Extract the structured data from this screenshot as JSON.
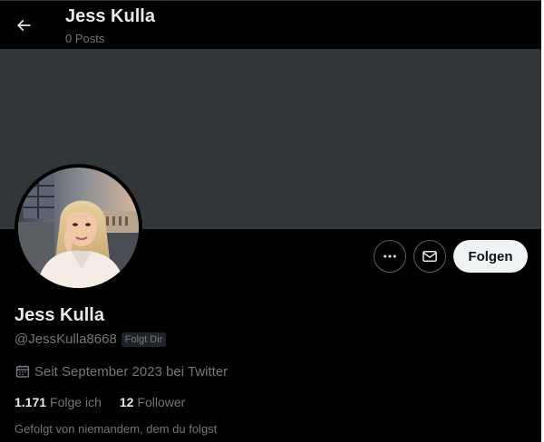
{
  "header": {
    "back_icon": "arrow-left-icon",
    "title": "Jess Kulla",
    "subtitle": "0 Posts"
  },
  "profile": {
    "banner_color": "#333639",
    "avatar_icon": "profile-photo",
    "name": "Jess Kulla",
    "handle": "@JessKulla8668",
    "follows_you_badge": "Folgt Dir",
    "joined": "Seit September 2023 bei Twitter",
    "joined_icon": "calendar-icon",
    "following_count": "1.171",
    "following_label": "Folge ich",
    "followers_count": "12",
    "followers_label": "Follower",
    "followed_by": "Gefolgt von niemandem, dem du folgst"
  },
  "actions": {
    "more_icon": "more-icon",
    "message_icon": "mail-icon",
    "follow_label": "Folgen"
  },
  "colors": {
    "background": "#000000",
    "primary_text": "#e7e9ea",
    "secondary_text": "#71767b",
    "border": "#536471",
    "follow_button_bg": "#eff3f4"
  }
}
